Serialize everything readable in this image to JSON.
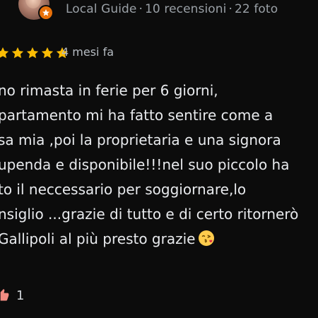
{
  "author": {
    "level": "Local Guide",
    "reviews": "10 recensioni",
    "photos": "22 foto",
    "separator": "·"
  },
  "review": {
    "stars": 5,
    "star_color": "#fbbc04",
    "date": "4 mesi fa",
    "lines": [
      "no rimasta in ferie per 6 giorni,",
      "partamento mi ha fatto sentire come a",
      "sa mia ,poi la proprietaria e una signora",
      "upenda e disponibile!!!nel suo piccolo ha",
      "to il neccessario per soggiornare,lo",
      "nsiglio ...grazie di tutto e di certo ritornerò",
      "Gallipoli al più presto grazie"
    ],
    "emoji": "face-blowing-a-kiss-icon"
  },
  "likes": {
    "count": "1",
    "icon": "thumbs-up-icon"
  },
  "colors": {
    "background": "#0c0c0c",
    "text": "#e8eaed",
    "meta": "#9aa0a6",
    "badge": "#e8710a"
  }
}
